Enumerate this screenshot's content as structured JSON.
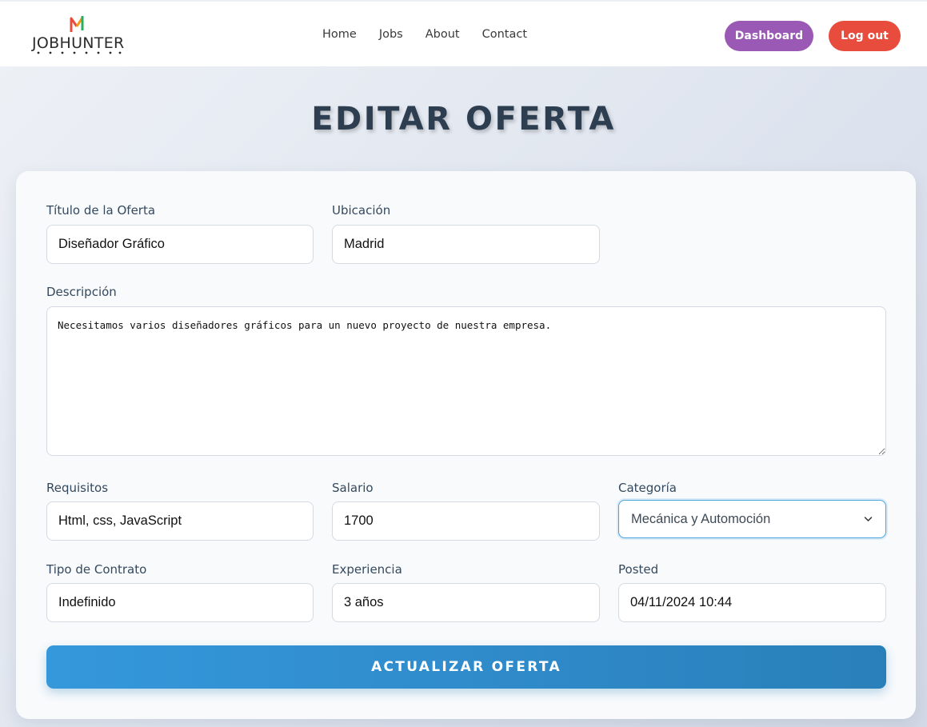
{
  "header": {
    "logo_text": "JOBHUNTER",
    "nav": [
      {
        "label": "Home"
      },
      {
        "label": "Jobs"
      },
      {
        "label": "About"
      },
      {
        "label": "Contact"
      }
    ],
    "dashboard_label": "Dashboard",
    "logout_label": "Log out"
  },
  "page": {
    "title": "EDITAR OFERTA"
  },
  "form": {
    "titulo": {
      "label": "Título de la Oferta",
      "value": "Diseñador Gráfico"
    },
    "ubicacion": {
      "label": "Ubicación",
      "value": "Madrid"
    },
    "descripcion": {
      "label": "Descripción",
      "value": "Necesitamos varios diseñadores gráficos para un nuevo proyecto de nuestra empresa."
    },
    "requisitos": {
      "label": "Requisitos",
      "value": "Html, css, JavaScript"
    },
    "salario": {
      "label": "Salario",
      "value": "1700"
    },
    "categoria": {
      "label": "Categoría",
      "value": "Mecánica y Automoción"
    },
    "tipo_contrato": {
      "label": "Tipo de Contrato",
      "value": "Indefinido"
    },
    "experiencia": {
      "label": "Experiencia",
      "value": "3 años"
    },
    "posted": {
      "label": "Posted",
      "value": "04/11/2024 10:44"
    },
    "submit_label": "ACTUALIZAR OFERTA"
  },
  "colors": {
    "dashboard": "#9b59b6",
    "logout": "#e74c3c",
    "primary": "#3498db",
    "heading": "#2c3e50"
  }
}
